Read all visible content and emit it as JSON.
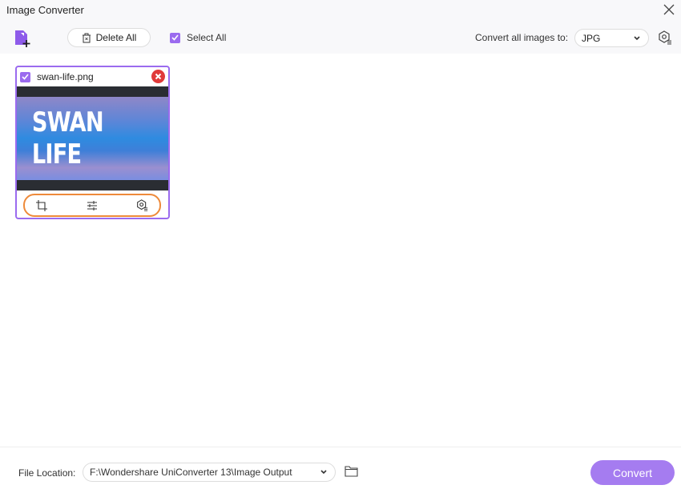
{
  "window": {
    "title": "Image Converter"
  },
  "toolbar": {
    "delete_all": "Delete All",
    "select_all": "Select All",
    "convert_label": "Convert all images to:",
    "format": "JPG"
  },
  "files": [
    {
      "name": "swan-life.png",
      "thumbnail_text": "SWAN LIFE",
      "checked": true
    }
  ],
  "footer": {
    "file_location_label": "File Location:",
    "path": "F:\\Wondershare UniConverter 13\\Image Output",
    "convert": "Convert"
  },
  "colors": {
    "accent": "#9b6bef",
    "highlight": "#ee8a3a",
    "remove": "#e03a3a"
  }
}
